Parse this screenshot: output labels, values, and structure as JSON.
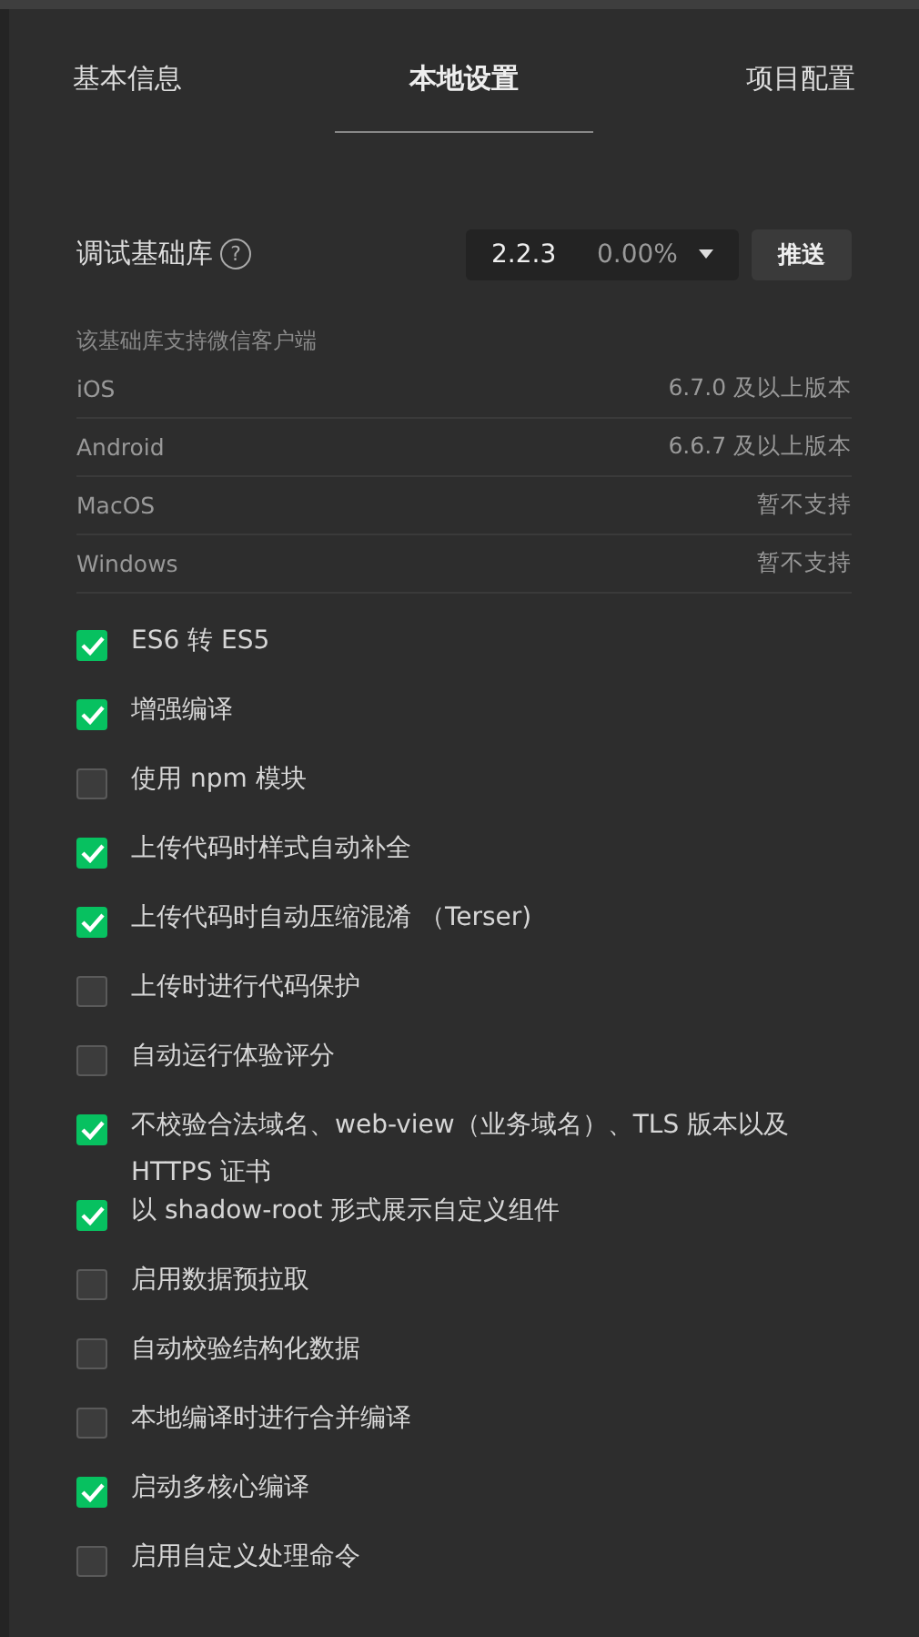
{
  "tabs": [
    {
      "label": "基本信息",
      "selected": false
    },
    {
      "label": "本地设置",
      "selected": true
    },
    {
      "label": "项目配置",
      "selected": false
    }
  ],
  "library": {
    "label": "调试基础库",
    "help_icon": "?",
    "version": "2.2.3",
    "percent": "0.00%",
    "push_button": "推送"
  },
  "support": {
    "caption": "该基础库支持微信客户端",
    "rows": [
      {
        "platform": "iOS",
        "requirement": "6.7.0 及以上版本"
      },
      {
        "platform": "Android",
        "requirement": "6.6.7 及以上版本"
      },
      {
        "platform": "MacOS",
        "requirement": "暂不支持"
      },
      {
        "platform": "Windows",
        "requirement": "暂不支持"
      }
    ]
  },
  "options": [
    {
      "label": "ES6 转 ES5",
      "checked": true
    },
    {
      "label": "增强编译",
      "checked": true
    },
    {
      "label": "使用 npm 模块",
      "checked": false
    },
    {
      "label": "上传代码时样式自动补全",
      "checked": true
    },
    {
      "label": "上传代码时自动压缩混淆 （Terser)",
      "checked": true
    },
    {
      "label": "上传时进行代码保护",
      "checked": false
    },
    {
      "label": "自动运行体验评分",
      "checked": false
    },
    {
      "label": "不校验合法域名、web-view（业务域名）、TLS 版本以及 HTTPS 证书",
      "checked": true
    },
    {
      "label": "以 shadow-root 形式展示自定义组件",
      "checked": true
    },
    {
      "label": "启用数据预拉取",
      "checked": false
    },
    {
      "label": "自动校验结构化数据",
      "checked": false
    },
    {
      "label": "本地编译时进行合并编译",
      "checked": false
    },
    {
      "label": "启动多核心编译",
      "checked": true
    },
    {
      "label": "启用自定义处理命令",
      "checked": false
    }
  ]
}
